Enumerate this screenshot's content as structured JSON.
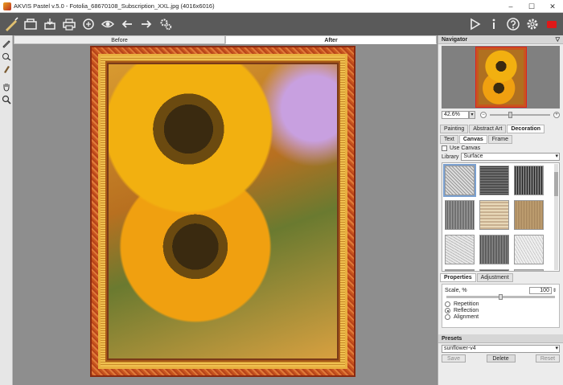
{
  "window": {
    "title": "AKVIS Pastel v.5.0 - Fotolia_68670108_Subscription_XXL.jpg (4016x6016)",
    "min": "–",
    "max": "☐",
    "close": "✕"
  },
  "view_tabs": {
    "before": "Before",
    "after": "After"
  },
  "navigator": {
    "title": "Navigator",
    "zoom": "42.6%",
    "zoom_minus": "−",
    "zoom_plus": "+"
  },
  "main_tabs": [
    "Painting",
    "Abstract Art",
    "Decoration"
  ],
  "sub_tabs": [
    "Text",
    "Canvas",
    "Frame"
  ],
  "canvas_opts": {
    "use_canvas": "Use Canvas",
    "library_label": "Library",
    "library_value": "Surface"
  },
  "properties": {
    "tab1": "Properties",
    "tab2": "Adjustment",
    "scale_label": "Scale, %",
    "scale_value": "100",
    "options": [
      "Repetition",
      "Reflection",
      "Alignment"
    ],
    "selected": "Reflection"
  },
  "presets": {
    "title": "Presets",
    "value": "sunflower-v4",
    "save": "Save",
    "delete": "Delete",
    "reset": "Reset"
  }
}
